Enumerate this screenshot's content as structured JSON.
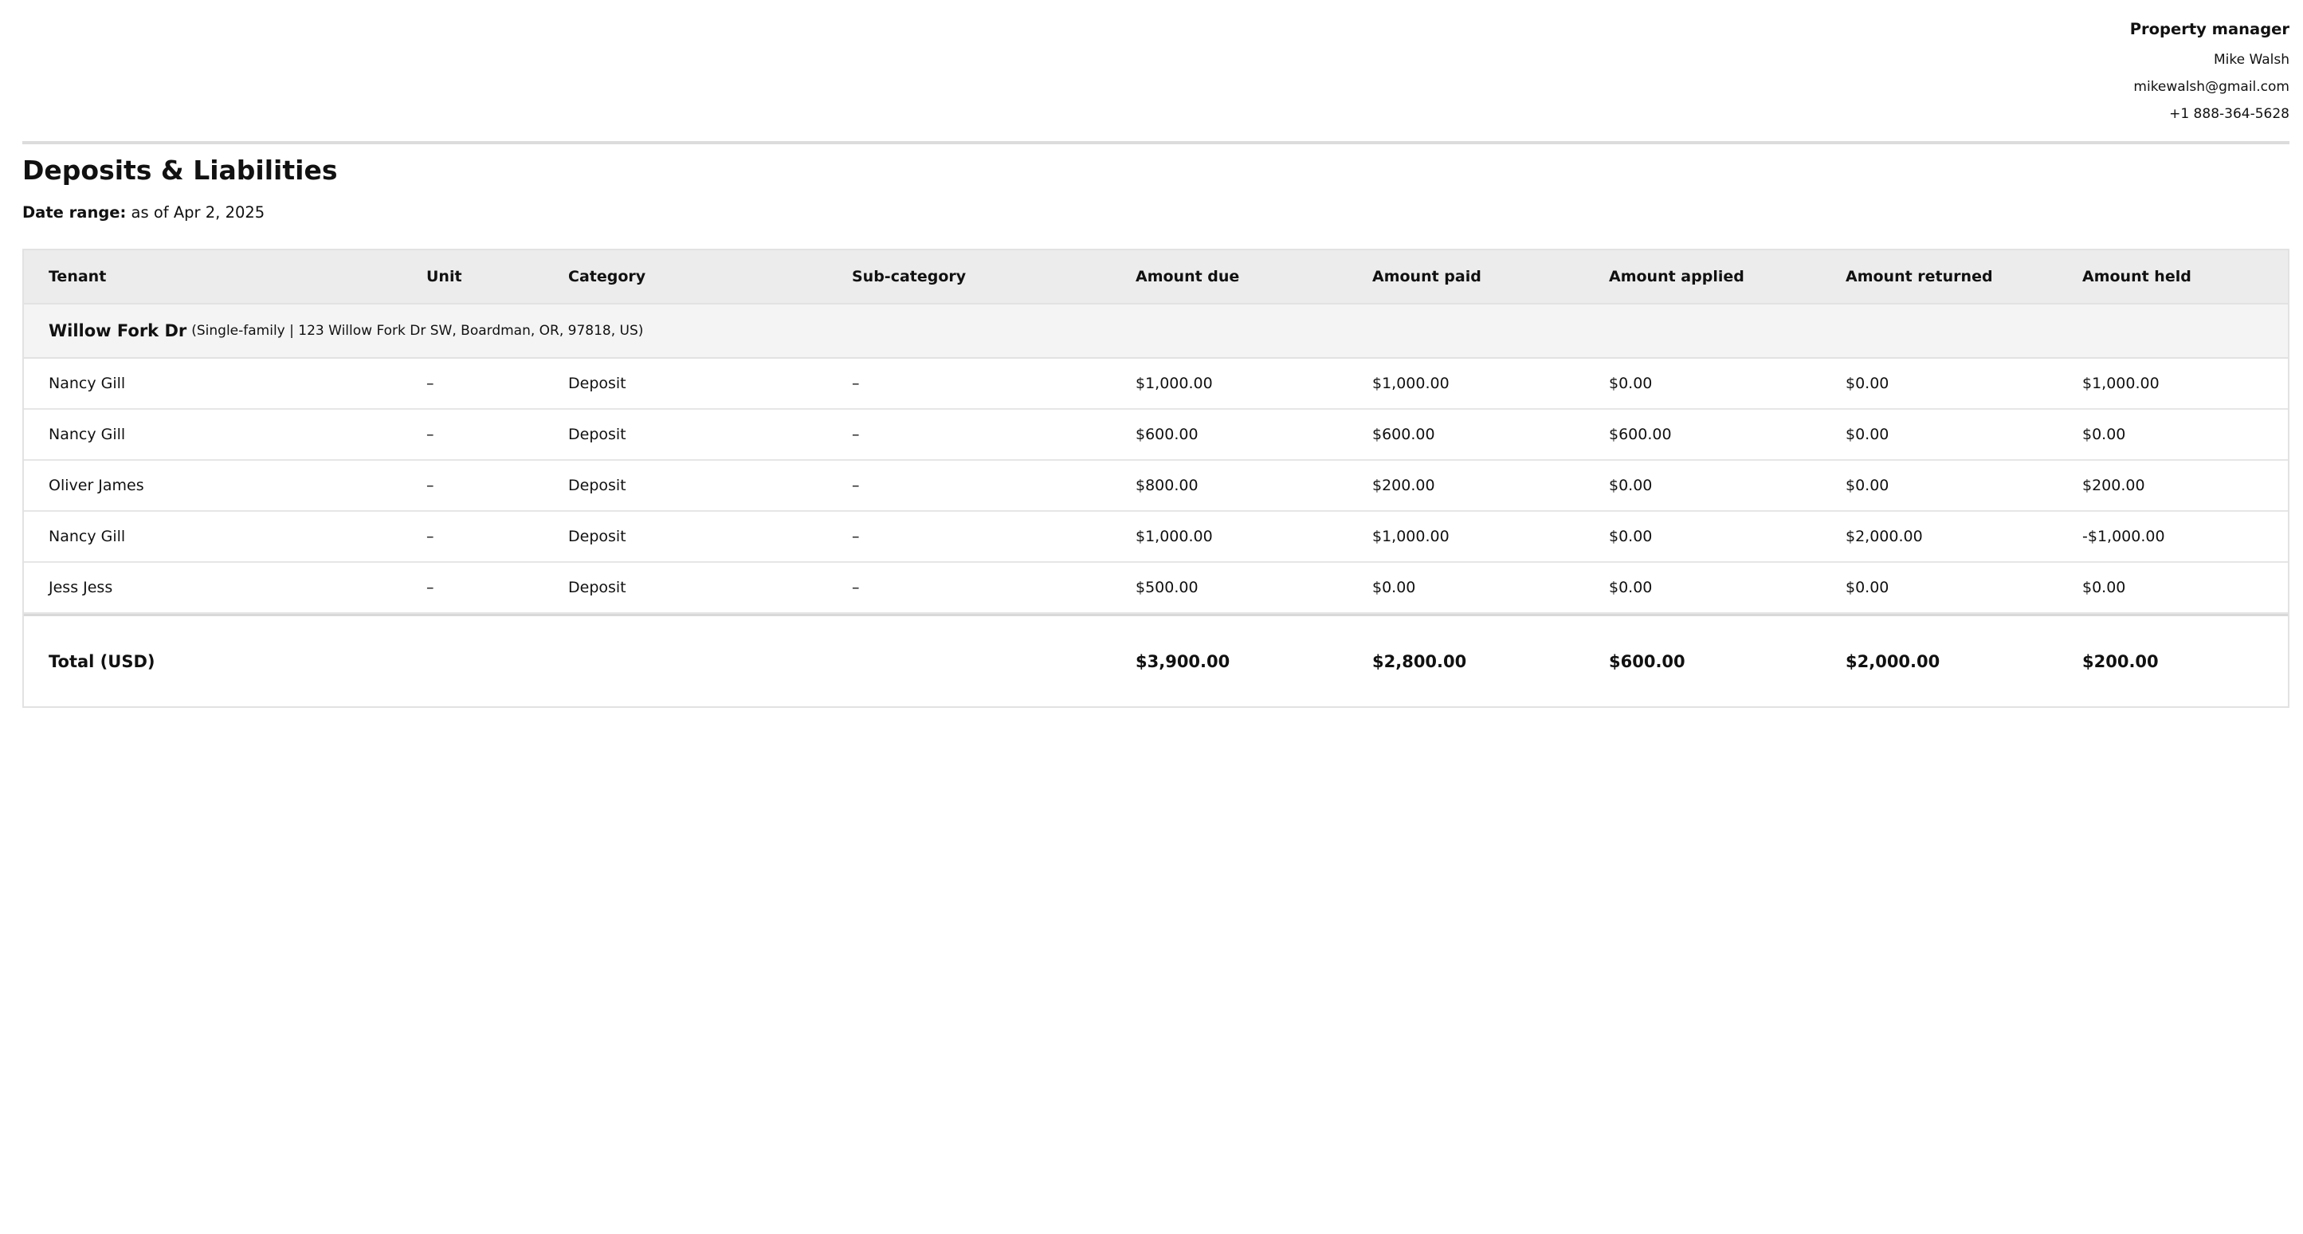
{
  "manager": {
    "role": "Property manager",
    "name": "Mike Walsh",
    "email": "mikewalsh@gmail.com",
    "phone": "+1 888-364-5628"
  },
  "report": {
    "title": "Deposits & Liabilities",
    "date_range_label": "Date range:",
    "date_range_value": "as of Apr 2, 2025"
  },
  "table": {
    "columns": [
      "Tenant",
      "Unit",
      "Category",
      "Sub-category",
      "Amount due",
      "Amount paid",
      "Amount applied",
      "Amount returned",
      "Amount held"
    ],
    "group": {
      "name": "Willow Fork Dr",
      "description": "(Single-family | 123 Willow Fork Dr SW, Boardman, OR, 97818, US)"
    },
    "rows": [
      [
        "Nancy Gill",
        "–",
        "Deposit",
        "–",
        "$1,000.00",
        "$1,000.00",
        "$0.00",
        "$0.00",
        "$1,000.00"
      ],
      [
        "Nancy Gill",
        "–",
        "Deposit",
        "–",
        "$600.00",
        "$600.00",
        "$600.00",
        "$0.00",
        "$0.00"
      ],
      [
        "Oliver James",
        "–",
        "Deposit",
        "–",
        "$800.00",
        "$200.00",
        "$0.00",
        "$0.00",
        "$200.00"
      ],
      [
        "Nancy Gill",
        "–",
        "Deposit",
        "–",
        "$1,000.00",
        "$1,000.00",
        "$0.00",
        "$2,000.00",
        "-$1,000.00"
      ],
      [
        "Jess Jess",
        "–",
        "Deposit",
        "–",
        "$500.00",
        "$0.00",
        "$0.00",
        "$0.00",
        "$0.00"
      ]
    ],
    "total": {
      "label": "Total (USD)",
      "amount_due": "$3,900.00",
      "amount_paid": "$2,800.00",
      "amount_applied": "$600.00",
      "amount_returned": "$2,000.00",
      "amount_held": "$200.00"
    }
  }
}
